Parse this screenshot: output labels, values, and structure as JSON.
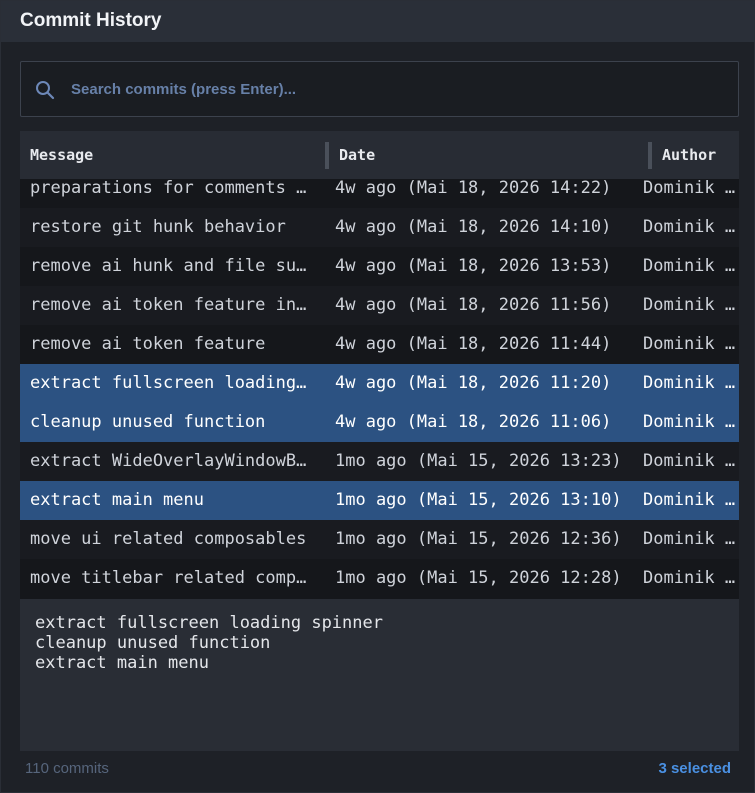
{
  "window": {
    "title": "Commit History"
  },
  "search": {
    "placeholder": "Search commits (press Enter)...",
    "value": ""
  },
  "table": {
    "columns": [
      "Message",
      "Date",
      "Author"
    ],
    "rows": [
      {
        "message": "preparations for comments …",
        "date": "4w ago (Mai 18, 2026 14:22)",
        "author": "Dominik …",
        "selected": false
      },
      {
        "message": "restore git hunk behavior",
        "date": "4w ago (Mai 18, 2026 14:10)",
        "author": "Dominik …",
        "selected": false
      },
      {
        "message": "remove ai hunk and file su…",
        "date": "4w ago (Mai 18, 2026 13:53)",
        "author": "Dominik …",
        "selected": false
      },
      {
        "message": "remove ai token feature in…",
        "date": "4w ago (Mai 18, 2026 11:56)",
        "author": "Dominik …",
        "selected": false
      },
      {
        "message": "remove ai token feature",
        "date": "4w ago (Mai 18, 2026 11:44)",
        "author": "Dominik …",
        "selected": false
      },
      {
        "message": "extract fullscreen loading…",
        "date": "4w ago (Mai 18, 2026 11:20)",
        "author": "Dominik …",
        "selected": true
      },
      {
        "message": "cleanup unused function",
        "date": "4w ago (Mai 18, 2026 11:06)",
        "author": "Dominik …",
        "selected": true
      },
      {
        "message": "extract WideOverlayWindowB…",
        "date": "1mo ago (Mai 15, 2026 13:23)",
        "author": "Dominik …",
        "selected": false
      },
      {
        "message": "extract main menu",
        "date": "1mo ago (Mai 15, 2026 13:10)",
        "author": "Dominik …",
        "selected": true
      },
      {
        "message": "move ui related composables",
        "date": "1mo ago (Mai 15, 2026 12:36)",
        "author": "Dominik …",
        "selected": false
      },
      {
        "message": "move titlebar related comp…",
        "date": "1mo ago (Mai 15, 2026 12:28)",
        "author": "Dominik …",
        "selected": false
      }
    ]
  },
  "details": {
    "lines": [
      "extract fullscreen loading spinner",
      "cleanup unused function",
      "extract main menu"
    ]
  },
  "footer": {
    "count": "110 commits",
    "selected": "3 selected"
  },
  "colors": {
    "selection": "#2c5282",
    "accent": "#4a90e2"
  },
  "icons": {
    "search": "search-icon"
  }
}
